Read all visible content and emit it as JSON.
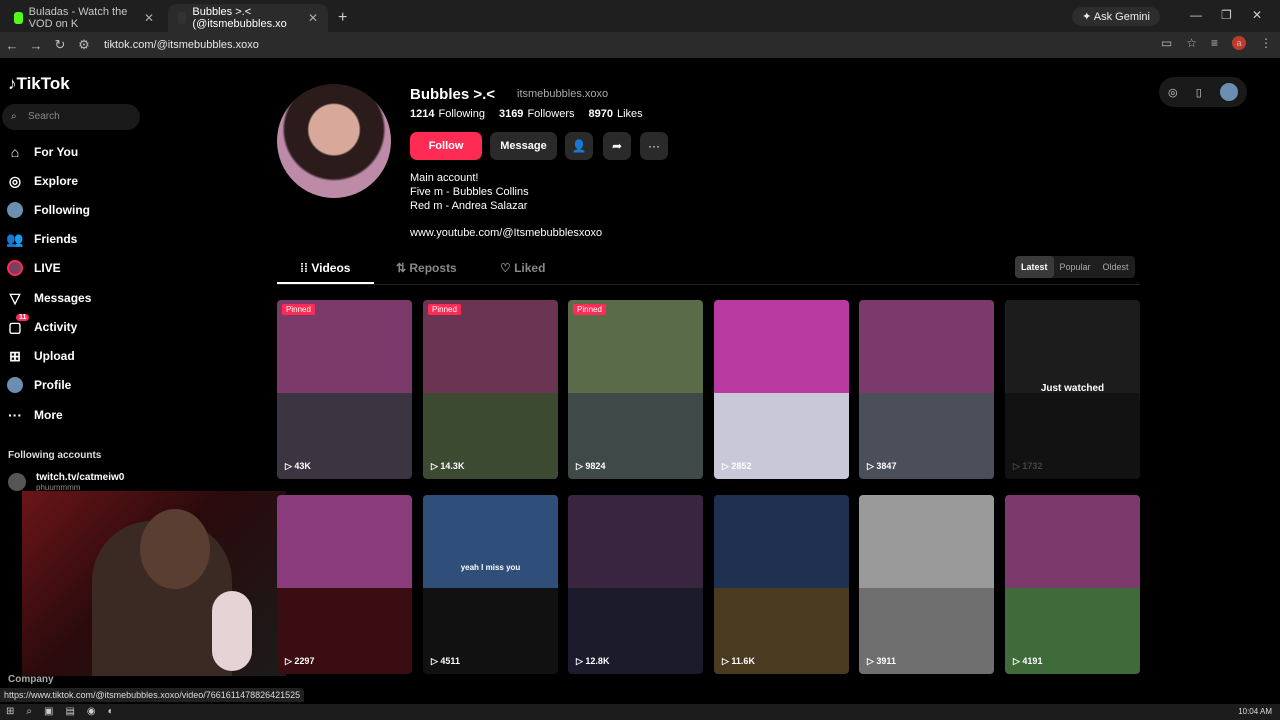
{
  "browser": {
    "tabs": [
      {
        "title": "Buladas - Watch the VOD on K",
        "color": "#53fc18"
      },
      {
        "title": "Bubbles >.< (@itsmebubbles.xo",
        "color": "#111"
      }
    ],
    "new_tab": "+",
    "gemini": "Ask Gemini",
    "url": "tiktok.com/@itsmebubbles.xoxo",
    "profile_initial": "a"
  },
  "sidebar": {
    "logo": "TikTok",
    "search_placeholder": "Search",
    "items": [
      {
        "label": "For You",
        "icon": "home-icon"
      },
      {
        "label": "Explore",
        "icon": "compass-icon"
      },
      {
        "label": "Following",
        "icon": "avatar-icon"
      },
      {
        "label": "Friends",
        "icon": "friends-icon"
      },
      {
        "label": "LIVE",
        "icon": "live-icon"
      },
      {
        "label": "Messages",
        "icon": "messages-icon"
      },
      {
        "label": "Activity",
        "icon": "activity-icon",
        "badge": "11"
      },
      {
        "label": "Upload",
        "icon": "upload-icon"
      },
      {
        "label": "Profile",
        "icon": "profile-icon"
      },
      {
        "label": "More",
        "icon": "more-icon"
      }
    ],
    "following_heading": "Following accounts",
    "following": [
      {
        "name": "twitch.tv/catmeiw0",
        "sub": "phuummmm"
      }
    ],
    "company": "Company"
  },
  "status_url": "https://www.tiktok.com/@itsmebubbles.xoxo/video/7661611478826421525",
  "profile": {
    "display_name": "Bubbles >.<",
    "handle": "itsmebubbles.xoxo",
    "following_count": "1214",
    "following_label": "Following",
    "followers_count": "3169",
    "followers_label": "Followers",
    "likes_count": "8970",
    "likes_label": "Likes",
    "follow_btn": "Follow",
    "message_btn": "Message",
    "bio": [
      "Main account!",
      "Five m - Bubbles Collins",
      "Red m - Andrea Salazar"
    ],
    "link": "www.youtube.com/@Itsmebubblesxoxo"
  },
  "tabs": {
    "videos": "Videos",
    "reposts": "Reposts",
    "liked": "Liked"
  },
  "sort": {
    "latest": "Latest",
    "popular": "Popular",
    "oldest": "Oldest"
  },
  "videos": [
    {
      "views": "43K",
      "pinned": "Pinned",
      "colors": [
        "#7c3a6b",
        "#3a3540"
      ]
    },
    {
      "views": "14.3K",
      "pinned": "Pinned",
      "colors": [
        "#6b3452",
        "#3d4a32"
      ]
    },
    {
      "views": "9824",
      "pinned": "Pinned",
      "colors": [
        "#5a6b4a",
        "#3f4a48"
      ]
    },
    {
      "views": "2852",
      "pinned": "",
      "colors": [
        "#b93aa0",
        "#c8c8d8"
      ]
    },
    {
      "views": "3847",
      "pinned": "",
      "colors": [
        "#7b3a6b",
        "#4a4f5a"
      ]
    },
    {
      "views": "1732",
      "pinned": "",
      "colors": [
        "#1c1c1c",
        "#121212"
      ],
      "overlay": "Just watched"
    },
    {
      "views": "2297",
      "pinned": "",
      "colors": [
        "#8a3b7b",
        "#3a0d12"
      ]
    },
    {
      "views": "4511",
      "pinned": "",
      "colors": [
        "#2f4f7a",
        "#111"
      ],
      "caption": "yeah I miss you"
    },
    {
      "views": "12.8K",
      "pinned": "",
      "colors": [
        "#3a2540",
        "#1b1b2b"
      ]
    },
    {
      "views": "11.6K",
      "pinned": "",
      "colors": [
        "#1f3050",
        "#4a3a20"
      ]
    },
    {
      "views": "3911",
      "pinned": "",
      "colors": [
        "#9a9a9a",
        "#6f6f6f"
      ]
    },
    {
      "views": "4191",
      "pinned": "",
      "colors": [
        "#7b3a6b",
        "#3f6a3a"
      ]
    }
  ],
  "taskbar": {
    "time": "10:04 AM"
  }
}
